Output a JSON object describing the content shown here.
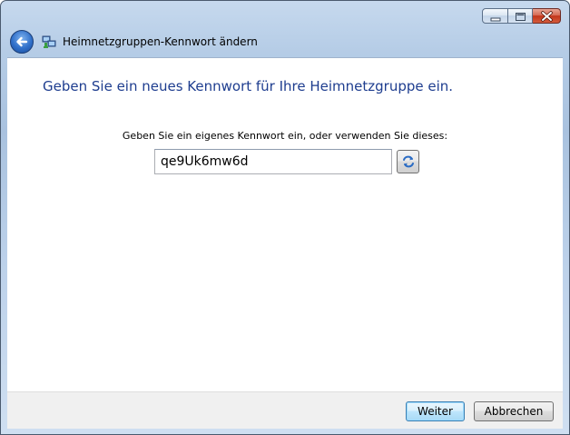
{
  "window": {
    "title": "Heimnetzgruppen-Kennwort ändern",
    "caption_buttons": {
      "minimize": "minimize-icon",
      "maximize": "maximize-icon",
      "close": "close-icon"
    }
  },
  "nav": {
    "back_icon": "back-arrow-icon",
    "app_icon": "homegroup-network-icon",
    "title": "Heimnetzgruppen-Kennwort ändern"
  },
  "main": {
    "heading": "Geben Sie ein neues Kennwort für Ihre Heimnetzgruppe ein.",
    "field_label": "Geben Sie ein eigenes Kennwort ein, oder verwenden Sie dieses:",
    "password_value": "qe9Uk6mw6d",
    "refresh_icon": "refresh-icon"
  },
  "footer": {
    "next_label": "Weiter",
    "cancel_label": "Abbrechen"
  },
  "colors": {
    "heading": "#1e3d8f",
    "frame": "#b5cce6",
    "close_button": "#c2351a",
    "default_button_border": "#3c7fb1"
  }
}
